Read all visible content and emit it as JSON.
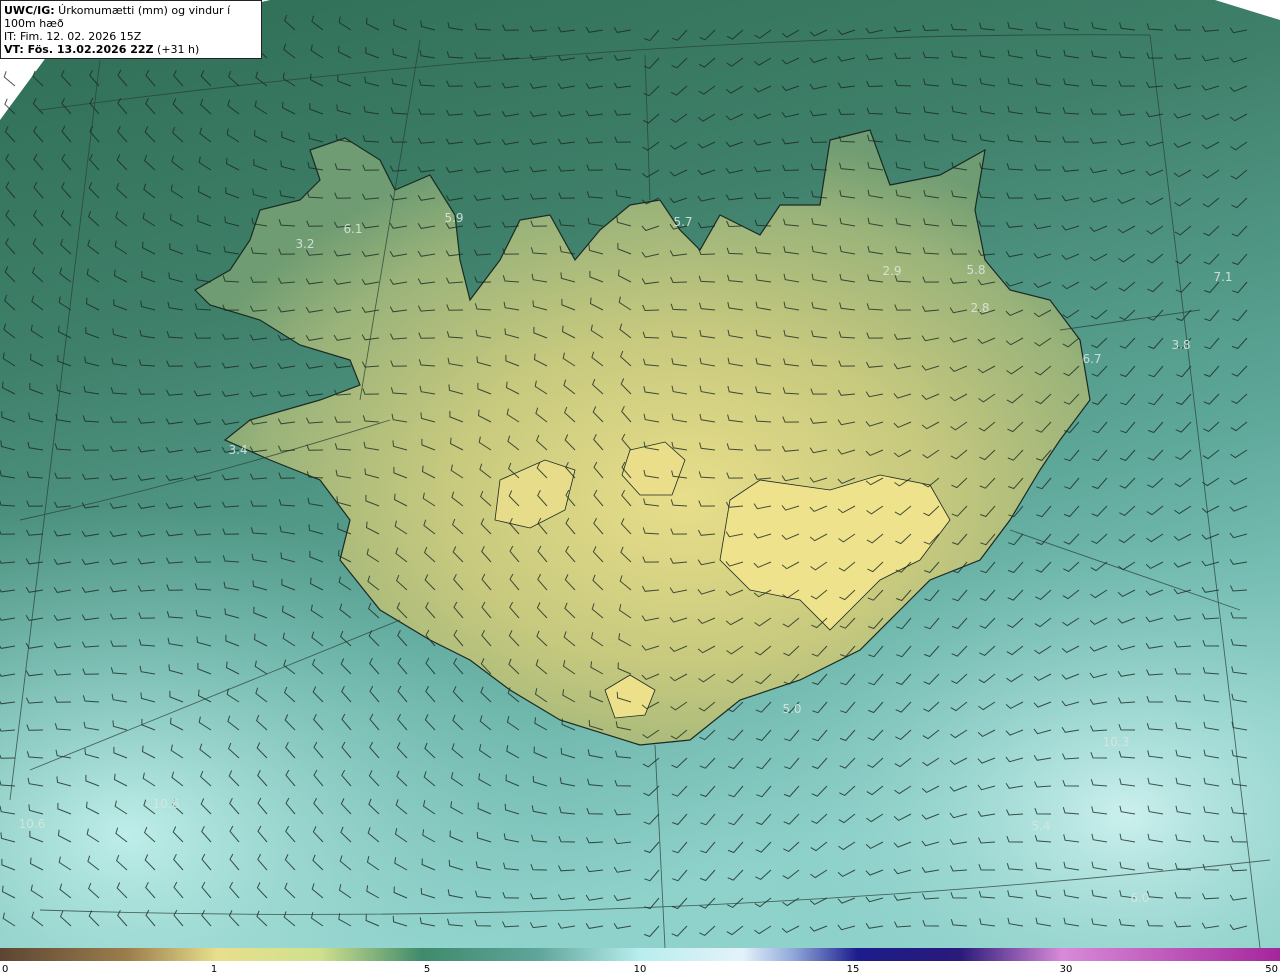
{
  "header": {
    "line1_bold": "UWC/IG:",
    "line1_rest": " Úrkomumætti (mm) og vindur í 100m hæð",
    "line2": "IT: Fim. 12. 02. 2026 15Z",
    "line3_bold_prefix": "VT: Fös. 13.02.2026 22Z",
    "line3_rest": " (+31 h)"
  },
  "map_values": [
    "5.9",
    "6.1",
    "3.2",
    "5.7",
    "2.9",
    "5.8",
    "2.8",
    "7.1",
    "3.8",
    "6.7",
    "3.4",
    "5.0",
    "10.3",
    "10.6",
    "10.6",
    "5.4",
    "6.0"
  ],
  "colorbar": {
    "ticks": [
      "0",
      "1",
      "5",
      "10",
      "15",
      "30",
      "50"
    ],
    "colors": [
      "#5c4533",
      "#9c7e4c",
      "#e8df8c",
      "#cfe08c",
      "#3f8a6c",
      "#5fa59a",
      "#b8eeee",
      "#e4f2fa",
      "#8fa8da",
      "#1c1c8c",
      "#2a1a7a",
      "#d88ad8",
      "#a4269c"
    ]
  }
}
